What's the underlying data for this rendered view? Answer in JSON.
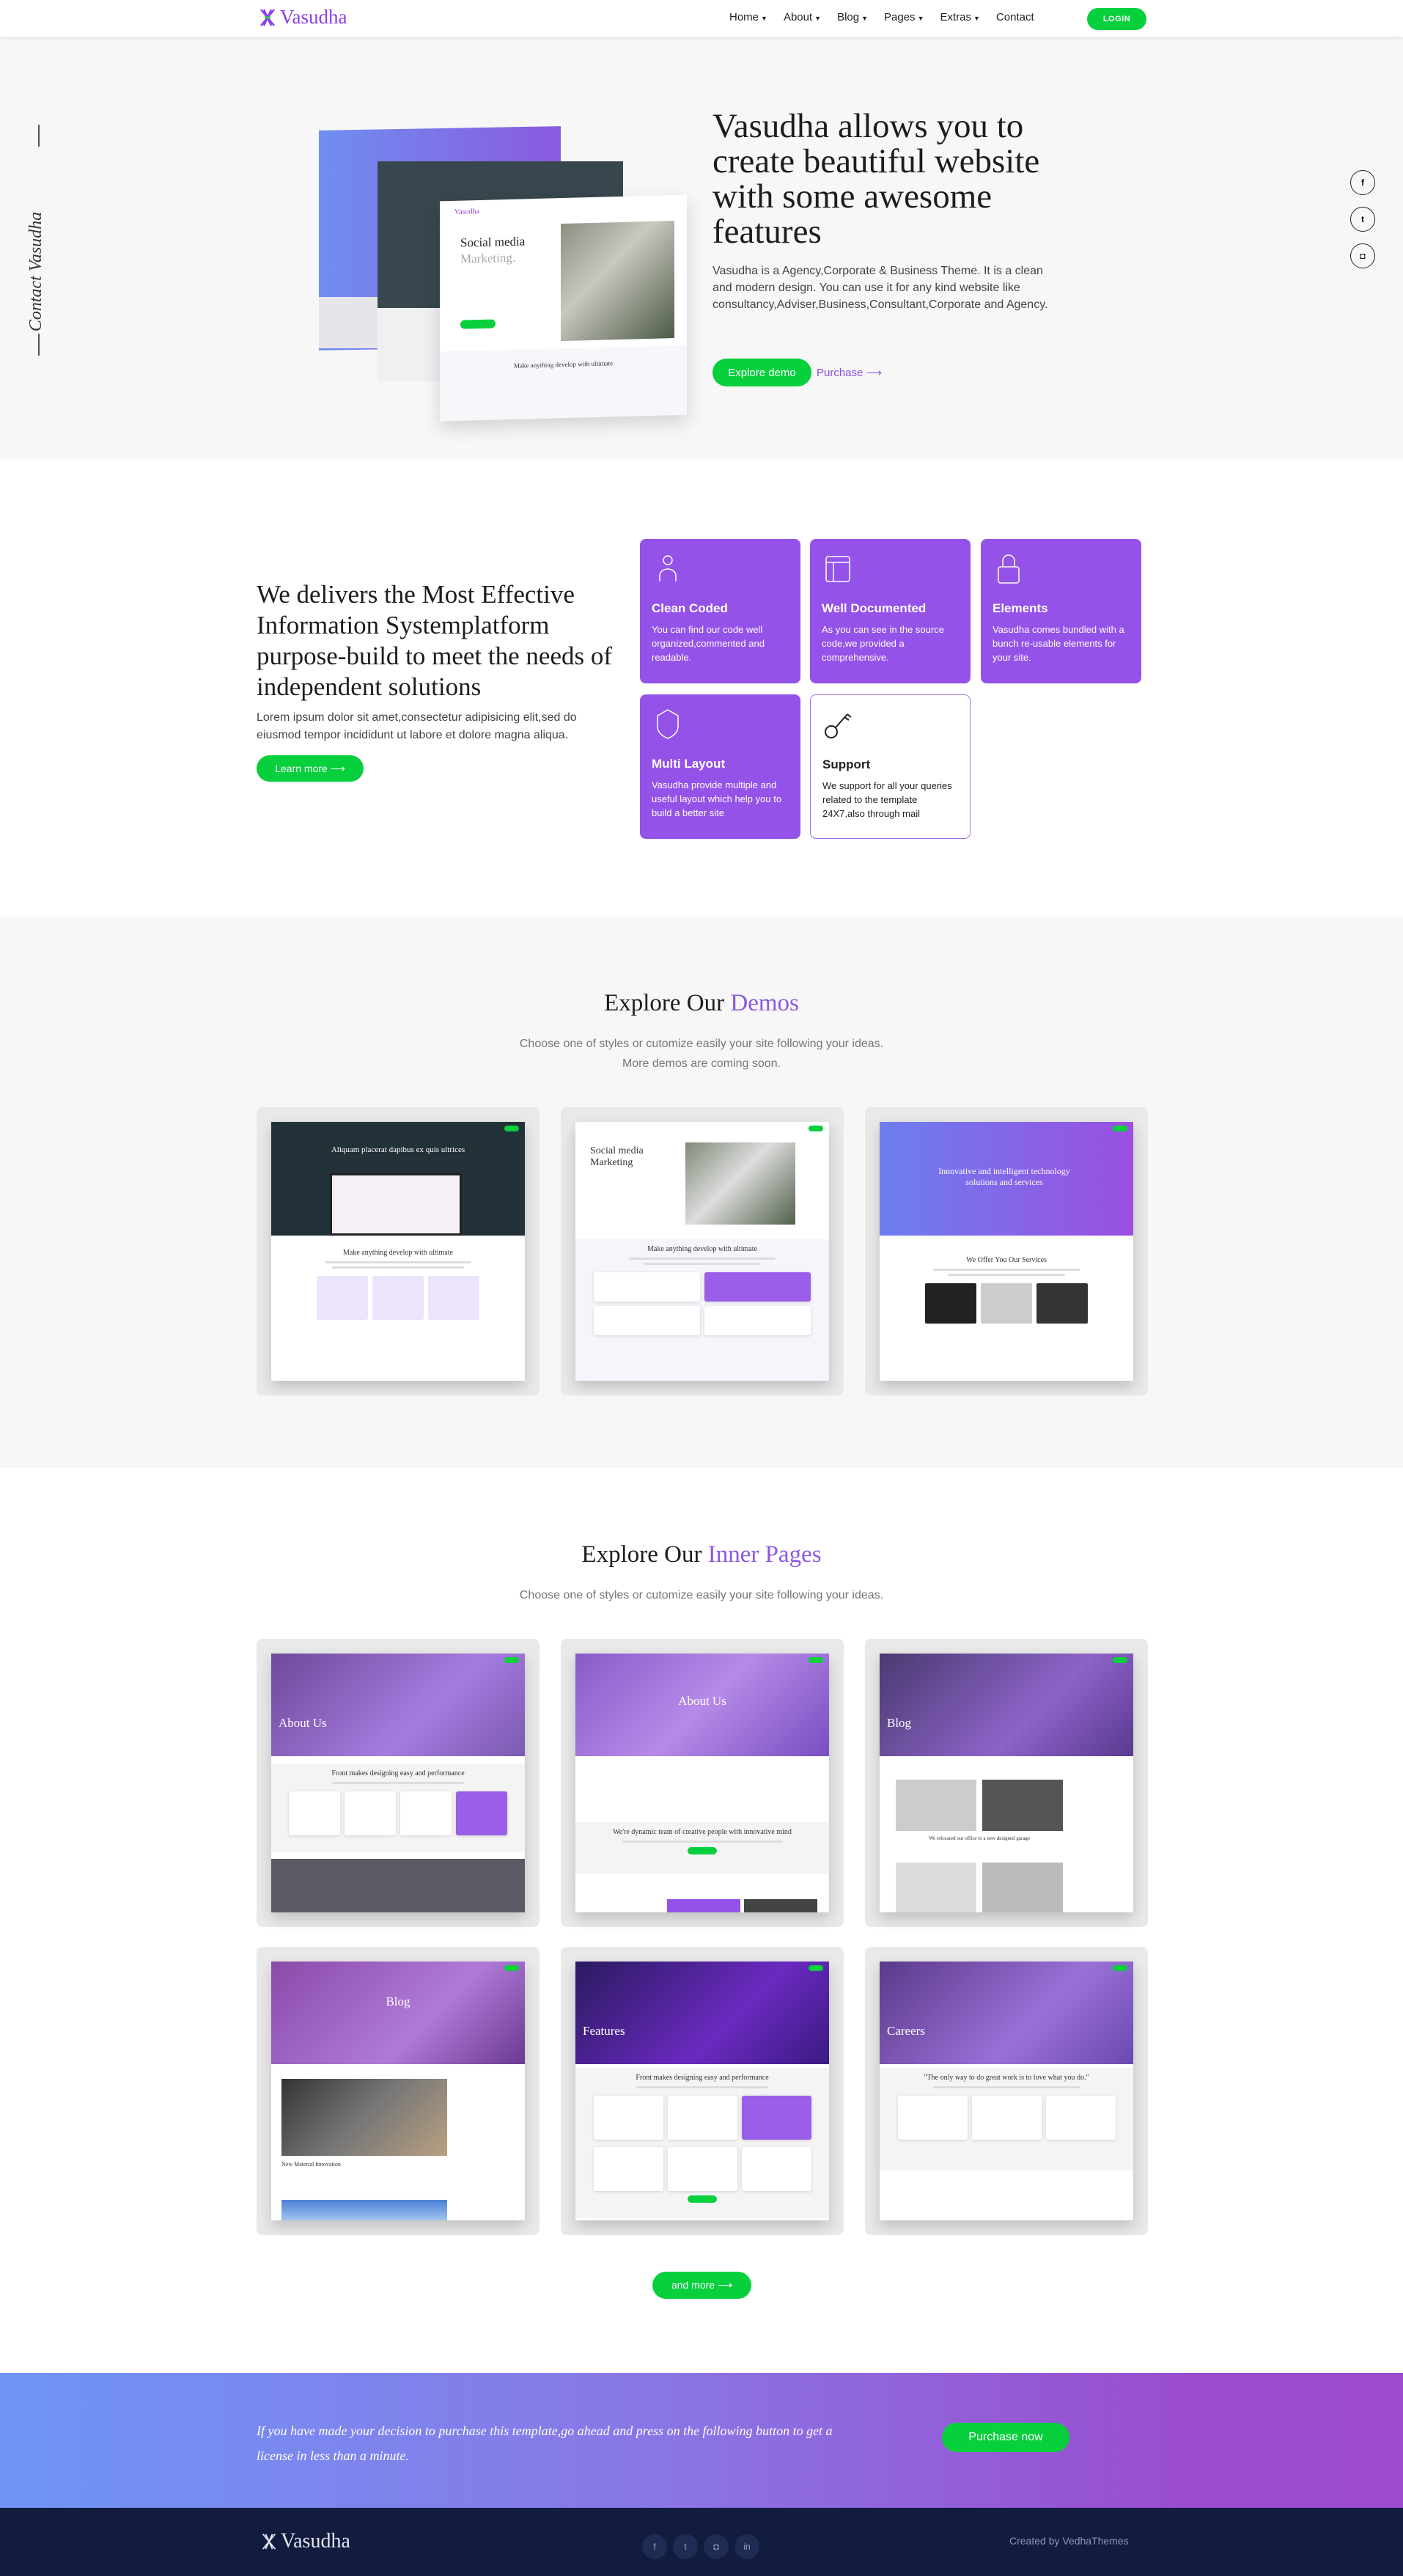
{
  "nav": {
    "brand": "Vasudha",
    "items": [
      {
        "label": "Home",
        "dropdown": true
      },
      {
        "label": "About",
        "dropdown": true
      },
      {
        "label": "Blog",
        "dropdown": true
      },
      {
        "label": "Pages",
        "dropdown": true
      },
      {
        "label": "Extras",
        "dropdown": true
      },
      {
        "label": "Contact",
        "dropdown": false
      }
    ],
    "login": "LOGIN"
  },
  "hero": {
    "side_text": "Contact Vasudha",
    "title": "Vasudha allows you to create beautiful website with some awesome features",
    "description": "Vasudha is a Agency,Corporate & Business Theme. It is a clean and modern design. You can use it for any kind website like consultancy,Adviser,Business,Consultant,Corporate and Agency.",
    "primary_button": "Explore demo",
    "secondary_link": "Purchase ⟶",
    "social": [
      "facebook-icon",
      "twitter-icon",
      "instagram-icon"
    ],
    "mockup": {
      "brand": "Vasudha",
      "title1": "Social media",
      "title2": "Marketing.",
      "section": "Make anything develop with ultimate"
    }
  },
  "features": {
    "title": "We delivers the Most Effective Information Systemplatform purpose-build to meet the needs of independent solutions",
    "description": "Lorem ipsum dolor sit amet,consectetur adipisicing elit,sed do eiusmod tempor incididunt ut labore et dolore magna aliqua.",
    "button": "Learn more ⟶",
    "cards": [
      {
        "icon": "user-icon",
        "title": "Clean Coded",
        "text": "You can find our code well organized,commented and readable."
      },
      {
        "icon": "layout-icon",
        "title": "Well Documented",
        "text": "As you can see in the source code,we provided a comprehensive."
      },
      {
        "icon": "lock-icon",
        "title": "Elements",
        "text": "Vasudha comes bundled with a bunch re-usable elements for your site."
      },
      {
        "icon": "shield-icon",
        "title": "Multi Layout",
        "text": "Vasudha provide multiple and useful layout which help you to build a better site"
      },
      {
        "icon": "key-icon",
        "title": "Support",
        "text": "We support for all your queries related to the template 24X7,also through mail"
      }
    ]
  },
  "demos": {
    "title_a": "Explore Our",
    "title_b": "Demos",
    "subtitle1": "Choose one of styles or cutomize easily your site following your ideas.",
    "subtitle2": "More demos are coming soon.",
    "items": [
      {
        "hero": "Aliquam placerat dapibus ex quis ultrices",
        "section": "Make anything develop with ultimate"
      },
      {
        "hero": "Social media Marketing",
        "section": "Make anything develop with ultimate"
      },
      {
        "hero": "Innovative and intelligent technology solutions and services",
        "section": "We Offer You Our Services"
      }
    ]
  },
  "inner": {
    "title_a": "Explore Our",
    "title_b": "Inner Pages",
    "subtitle": "Choose one of styles or cutomize easily your site following your ideas.",
    "items": [
      {
        "hero": "About Us",
        "section": "Front makes designing easy and performance"
      },
      {
        "hero": "About Us",
        "section": "We're dynamic team of creative people with innovative mind"
      },
      {
        "hero": "Blog",
        "section": "We relocated our office to a new designed garage"
      },
      {
        "hero": "Blog",
        "section": "New Material Innovation"
      },
      {
        "hero": "Features",
        "section": "Front makes designing easy and performance"
      },
      {
        "hero": "Careers",
        "section": "\"The only way to do great work is to love what you do.\""
      }
    ],
    "more_button": "and more ⟶"
  },
  "cta": {
    "text": "If you have made your decision to purchase this template,go ahead and press on the following button to get a license in less than a minute.",
    "button": "Purchase now"
  },
  "footer": {
    "brand": "Vasudha",
    "social": [
      "facebook-icon",
      "twitter-icon",
      "instagram-icon",
      "linkedin-icon"
    ],
    "credit": "Created by VedhaThemes"
  },
  "colors": {
    "accent": "#9452e8",
    "green": "#08cf3c",
    "footer": "#111c3e"
  }
}
